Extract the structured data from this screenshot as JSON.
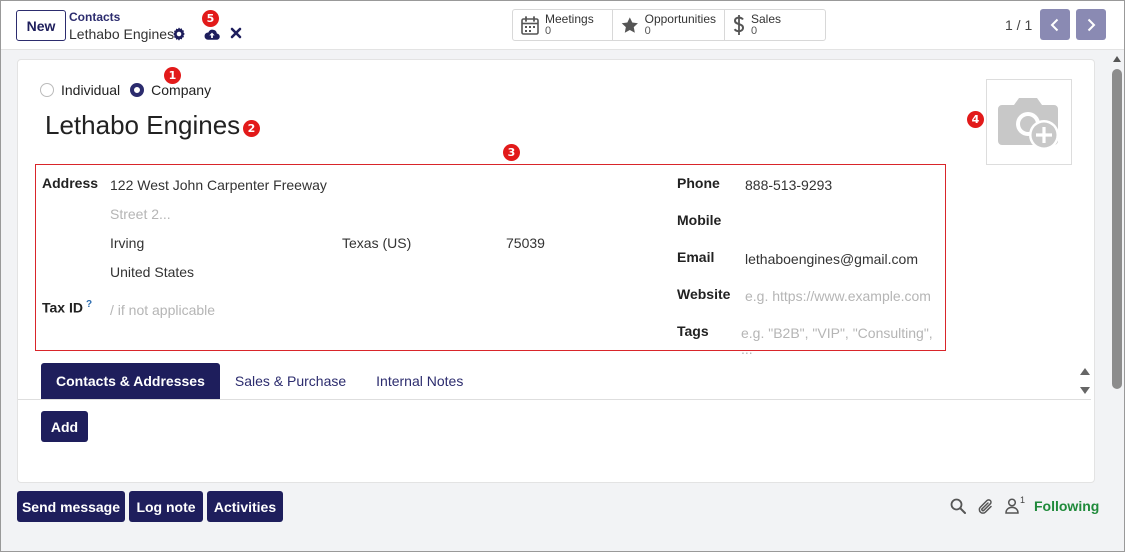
{
  "control_panel": {
    "new_label": "New",
    "breadcrumb_parent": "Contacts",
    "breadcrumb_current": "Lethabo Engines",
    "pager_value": "1 / 1",
    "smart_buttons": [
      {
        "label": "Meetings",
        "value": "0",
        "icon": "calendar-icon"
      },
      {
        "label": "Opportunities",
        "value": "0",
        "icon": "star-icon"
      },
      {
        "label": "Sales",
        "value": "0",
        "icon": "dollar-icon"
      }
    ]
  },
  "annotations": [
    "1",
    "2",
    "3",
    "4",
    "5"
  ],
  "form": {
    "company_type_options": [
      {
        "label": "Individual",
        "checked": false
      },
      {
        "label": "Company",
        "checked": true
      }
    ],
    "name": "Lethabo Engines",
    "address_label": "Address",
    "street": "122 West John Carpenter Freeway",
    "street2_placeholder": "Street 2...",
    "city": "Irving",
    "state": "Texas (US)",
    "zip": "75039",
    "country": "United States",
    "tax_id_label": "Tax ID",
    "tax_id_help": "?",
    "tax_id_placeholder": "/ if not applicable",
    "phone_label": "Phone",
    "phone": "888-513-9293",
    "mobile_label": "Mobile",
    "email_label": "Email",
    "email": "lethaboengines@gmail.com",
    "website_label": "Website",
    "website_placeholder": "e.g. https://www.example.com",
    "tags_label": "Tags",
    "tags_placeholder": "e.g. \"B2B\", \"VIP\", \"Consulting\", ..."
  },
  "notebook": {
    "tabs": [
      "Contacts & Addresses",
      "Sales & Purchase",
      "Internal Notes"
    ],
    "active_tab": 0,
    "add_label": "Add"
  },
  "chatter": {
    "send_message": "Send message",
    "log_note": "Log note",
    "activities": "Activities",
    "followers_count": "1",
    "following": "Following"
  },
  "colors": {
    "primary": "#1e1e5c",
    "annotation": "#e21a1a",
    "following": "#1f8a3a",
    "highlight_box": "#d9252a"
  }
}
